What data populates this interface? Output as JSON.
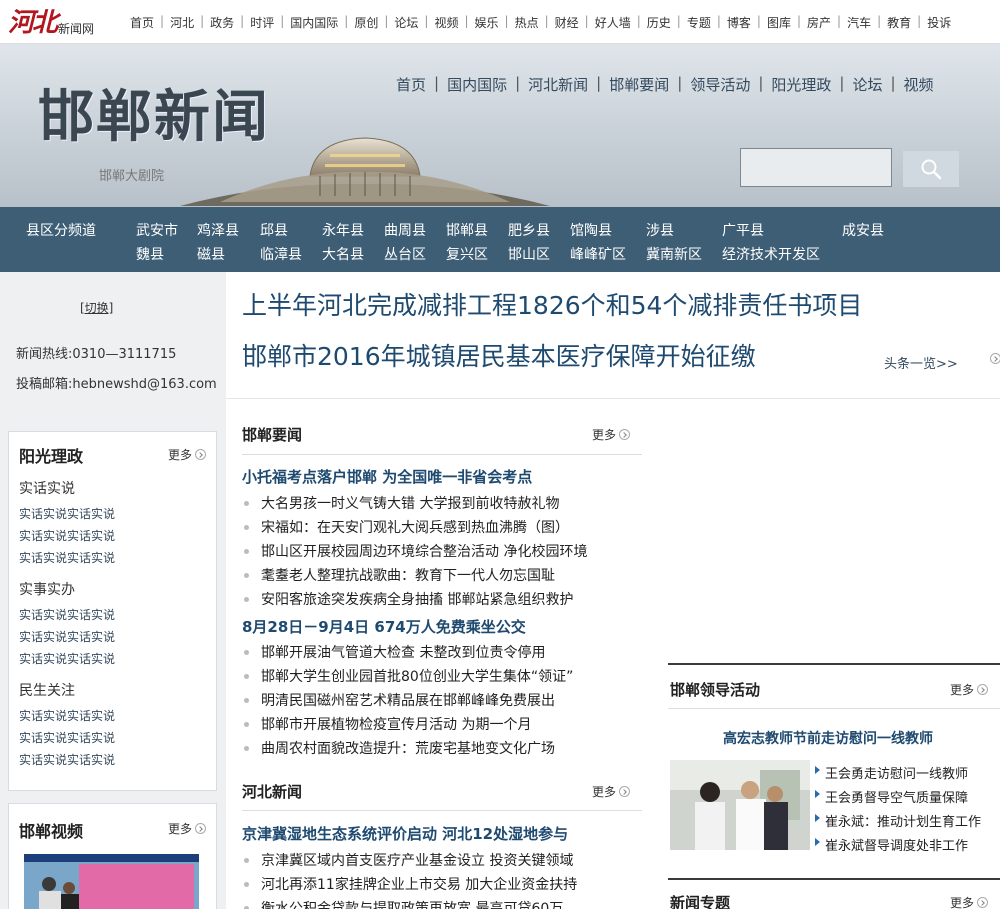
{
  "topbar": {
    "logo_main": "河北",
    "logo_sub": "新闻网",
    "nav": [
      "首页",
      "河北",
      "政务",
      "时评",
      "国内国际",
      "原创",
      "论坛",
      "视频",
      "娱乐",
      "热点",
      "财经",
      "好人墙",
      "历史",
      "专题",
      "博客",
      "图库",
      "房产",
      "汽车",
      "教育",
      "投诉"
    ]
  },
  "header": {
    "site_title": "邯郸新闻",
    "theatre_caption": "邯郸大剧院",
    "nav": [
      "首页",
      "国内国际",
      "河北新闻",
      "邯郸要闻",
      "领导活动",
      "阳光理政",
      "论坛",
      "视频"
    ],
    "search": {
      "value": "",
      "placeholder": ""
    }
  },
  "county_bar": {
    "label": "县区分频道",
    "row1": [
      "武安市",
      "鸡泽县",
      "邱县",
      "永年县",
      "曲周县",
      "邯郸县",
      "肥乡县",
      "馆陶县",
      "涉县",
      "广平县",
      "成安县"
    ],
    "row2": [
      "魏县",
      "磁县",
      "临漳县",
      "大名县",
      "丛台区",
      "复兴区",
      "邯山区",
      "峰峰矿区",
      "冀南新区",
      "经济技术开发区"
    ]
  },
  "sidebar": {
    "switch_label": "[切换]",
    "hotline": "新闻热线:0310—3111715",
    "mailbox": "投稿邮箱:hebnewshd@163.com",
    "sunshine": {
      "title": "阳光理政",
      "more": "更多",
      "groups": [
        {
          "title": "实话实说",
          "items": [
            "实话实说实话实说",
            "实话实说实话实说",
            "实话实说实话实说"
          ]
        },
        {
          "title": "实事实办",
          "items": [
            "实话实说实话实说",
            "实话实说实话实说",
            "实话实说实话实说"
          ]
        },
        {
          "title": "民生关注",
          "items": [
            "实话实说实话实说",
            "实话实说实话实说",
            "实话实说实话实说"
          ]
        }
      ]
    },
    "video": {
      "title": "邯郸视频",
      "more": "更多"
    }
  },
  "headlines": {
    "items": [
      "上半年河北完成减排工程1826个和54个减排责任书项目",
      "邯郸市2016年城镇居民基本医疗保障开始征缴"
    ],
    "more": "头条一览>>"
  },
  "handan_news": {
    "title": "邯郸要闻",
    "more": "更多",
    "lead1": "小托福考点落户邯郸 为全国唯一非省会考点",
    "list1": [
      "大名男孩一时义气铸大错 大学报到前收特赦礼物",
      "宋福如：在天安门观礼大阅兵感到热血沸腾（图）",
      "邯山区开展校园周边环境综合整治活动 净化校园环境",
      "耄耋老人整理抗战歌曲：教育下一代人勿忘国耻",
      "安阳客旅途突发疾病全身抽搐 邯郸站紧急组织救护"
    ],
    "lead2": "8月28日－9月4日 674万人免费乘坐公交",
    "list2": [
      "邯郸开展油气管道大检查 未整改到位责令停用",
      "邯郸大学生创业园首批80位创业大学生集体“领证”",
      "明清民国磁州窑艺术精品展在邯郸峰峰免费展出",
      "邯郸市开展植物检疫宣传月活动 为期一个月",
      "曲周农村面貌改造提升：荒废宅基地变文化广场"
    ]
  },
  "hebei_news": {
    "title": "河北新闻",
    "more": "更多",
    "lead": "京津冀湿地生态系统评价启动 河北12处湿地参与",
    "list": [
      "京津冀区域内首支医疗产业基金设立 投资关键领域",
      "河北再添11家挂牌企业上市交易 加大企业资金扶持",
      "衡水公积金贷款与提取政策再放宽 最高可贷60万"
    ]
  },
  "leaders": {
    "title": "邯郸领导活动",
    "more": "更多",
    "headline": "高宏志教师节前走访慰问一线教师",
    "list": [
      "王会勇走访慰问一线教师",
      "王会勇督导空气质量保障",
      "崔永斌：推动计划生育工作",
      "崔永斌督导调度处非工作"
    ]
  },
  "topics": {
    "title": "新闻专题",
    "more": "更多"
  }
}
